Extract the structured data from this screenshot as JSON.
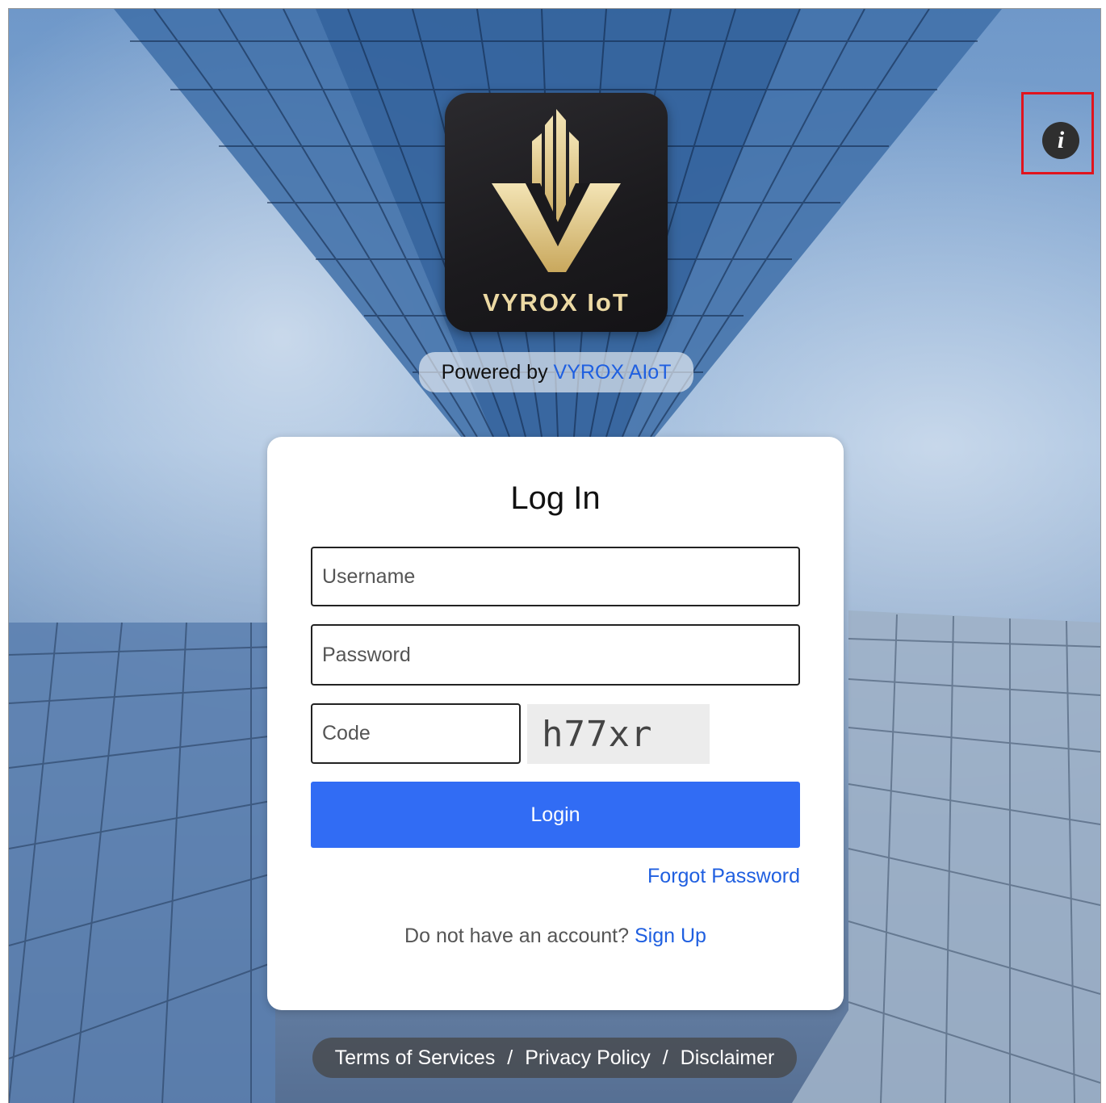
{
  "logo": {
    "text": "VYROX IoT"
  },
  "powered": {
    "prefix": "Powered by",
    "link_label": "VYROX AIoT"
  },
  "login": {
    "title": "Log In",
    "username_placeholder": "Username",
    "password_placeholder": "Password",
    "code_placeholder": "Code",
    "captcha_text": "h77xr",
    "login_label": "Login",
    "forgot_label": "Forgot Password",
    "no_account_text": "Do not have an account?",
    "signup_label": "Sign Up"
  },
  "footer": {
    "terms_label": "Terms of Services",
    "privacy_label": "Privacy Policy",
    "disclaimer_label": "Disclaimer",
    "separator": "/"
  },
  "icons": {
    "info": "info-icon"
  },
  "colors": {
    "accent": "#316cf4",
    "link": "#1f5fe0",
    "highlight": "#e0141e",
    "logo_gold": "#ecd9a3"
  }
}
